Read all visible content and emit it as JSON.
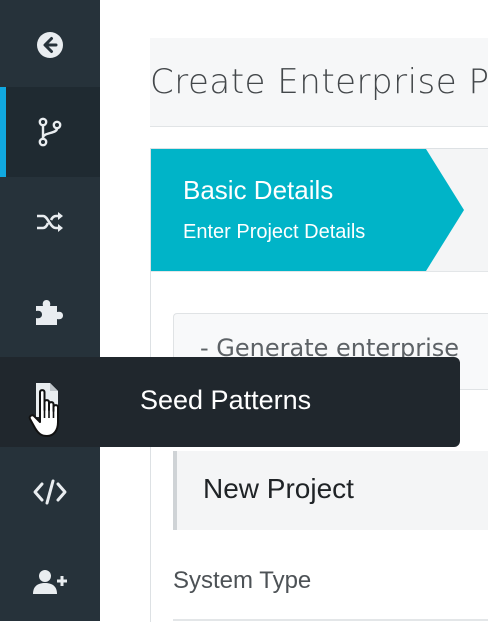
{
  "sidebar": {
    "items": [
      {
        "icon": "arrow-left-circle-icon"
      },
      {
        "icon": "branch-icon",
        "active": true
      },
      {
        "icon": "shuffle-icon"
      },
      {
        "icon": "puzzle-icon"
      },
      {
        "icon": "file-icon"
      },
      {
        "icon": "code-icon"
      },
      {
        "icon": "user-plus-icon"
      }
    ],
    "tooltip": "Seed Patterns"
  },
  "page": {
    "title": "Create Enterprise P"
  },
  "wizard": {
    "step": {
      "title": "Basic Details",
      "subtitle": "Enter Project Details"
    }
  },
  "generate_panel": {
    "text": "- Generate enterprise"
  },
  "project": {
    "name": "New Project"
  },
  "form": {
    "system_type_label": "System Type"
  },
  "colors": {
    "sidebar": "#26323a",
    "active_accent": "#10a8e0",
    "step_accent": "#00b4c8",
    "tooltip": "#20272d"
  }
}
